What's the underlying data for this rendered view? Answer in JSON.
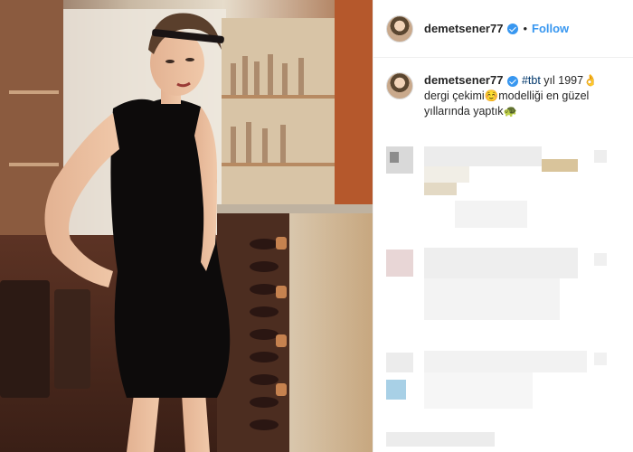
{
  "post": {
    "username": "demetsener77",
    "separator": "•",
    "follow_label": "Follow",
    "caption": {
      "username": "demetsener77",
      "hashtag": "#tbt",
      "text": " yıl 1997👌dergi çekimi☺️modelliği en güzel yıllarında yaptık🐢"
    }
  },
  "colors": {
    "accent": "#3897f0",
    "text": "#262626",
    "hashtag": "#00376b"
  },
  "icons": {
    "verified": "verified-badge-icon"
  }
}
